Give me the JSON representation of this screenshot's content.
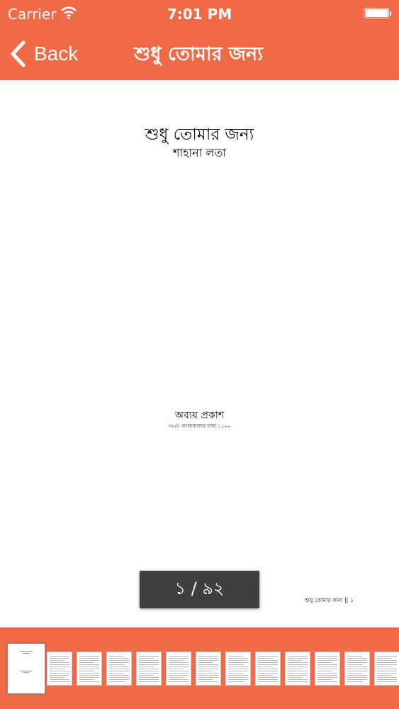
{
  "status_bar": {
    "carrier": "Carrier",
    "time": "7:01 PM"
  },
  "nav": {
    "back_label": "Back",
    "title": "শুধু তোমার জন্য"
  },
  "page": {
    "book_title": "শুধু তোমার জন্য",
    "author": "শাহানা লতা",
    "publisher": "অব্যয় প্রকাশ",
    "publisher_address": "৩৮/৪ বাংলাবাজার ঢাকা ১১০০",
    "footer": "শুধু তোমার জন্য || ১"
  },
  "page_counter": "১ / ৯২",
  "thumbnails": {
    "count": 13,
    "active_index": 0
  },
  "colors": {
    "accent": "#ef6a45",
    "counter_bg": "#3f3f3f"
  }
}
